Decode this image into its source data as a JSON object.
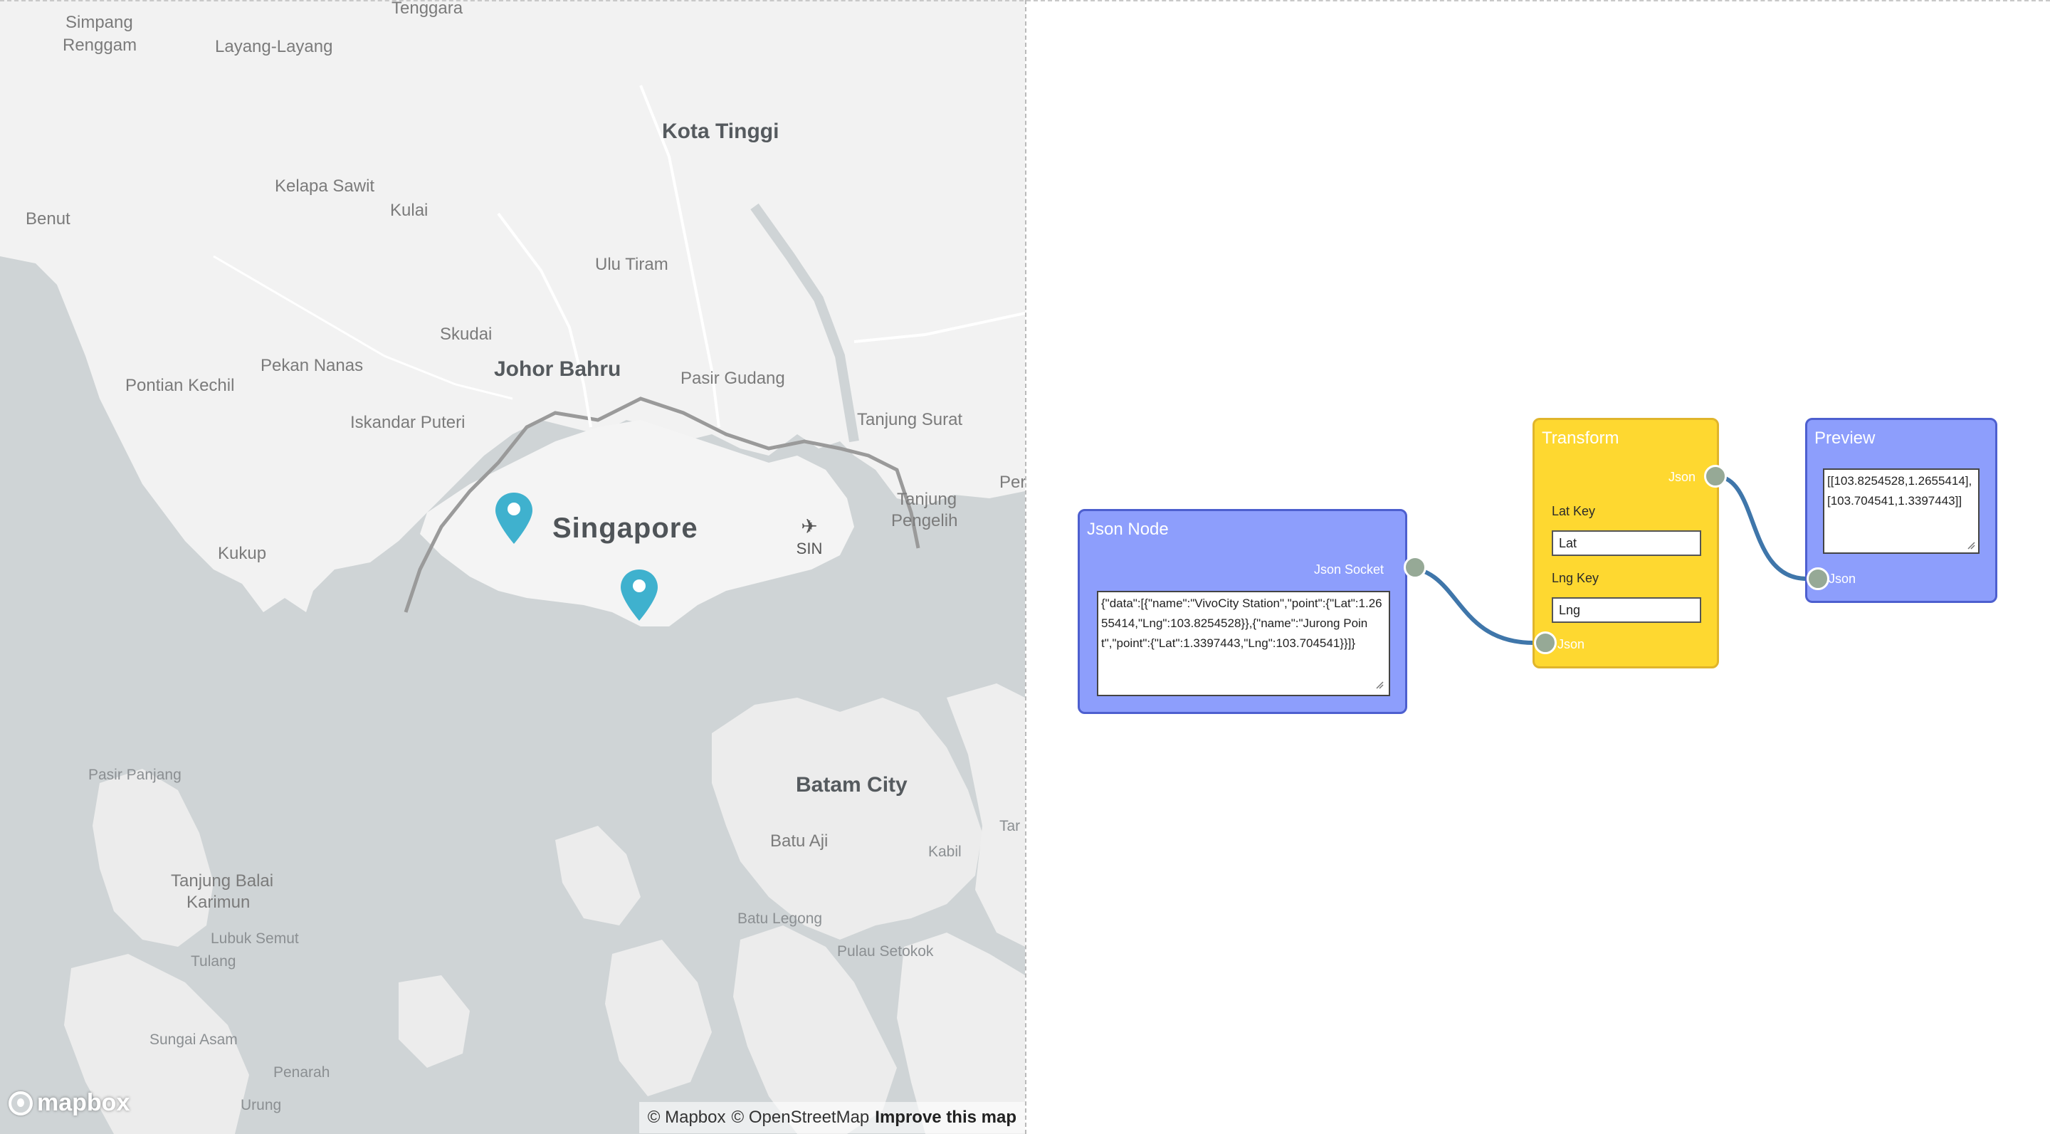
{
  "map": {
    "places": {
      "simpang_renggam_1": "Simpang",
      "simpang_renggam_2": "Renggam",
      "tenggara": "Tenggara",
      "layang_layang": "Layang-Layang",
      "kota_tinggi": "Kota Tinggi",
      "kelapa_sawit": "Kelapa Sawit",
      "benut": "Benut",
      "kulai": "Kulai",
      "ulu_tiram": "Ulu Tiram",
      "skudai": "Skudai",
      "pekan_nanas": "Pekan Nanas",
      "johor_bahru": "Johor Bahru",
      "pasir_gudang": "Pasir Gudang",
      "pontian_kechil": "Pontian Kechil",
      "iskandar_puteri": "Iskandar Puteri",
      "tanjung_surat": "Tanjung Surat",
      "tanjung_pengelih_1": "Tanjung",
      "tanjung_pengelih_2": "Pengelih",
      "per": "Per",
      "singapore": "Singapore",
      "kukup": "Kukup",
      "pasir_panjang": "Pasir Panjang",
      "batam_city": "Batam City",
      "batu_aji": "Batu Aji",
      "kabil": "Kabil",
      "tar": "Tar",
      "tanjung_balai_karimun_1": "Tanjung Balai",
      "tanjung_balai_karimun_2": "Karimun",
      "lubuk_semut": "Lubuk Semut",
      "tulang": "Tulang",
      "batu_legong": "Batu Legong",
      "pulau_setokok": "Pulau Setokok",
      "sungai_asam": "Sungai Asam",
      "penarah": "Penarah",
      "urung": "Urung"
    },
    "airport_code": "SIN",
    "airport_icon": "✈",
    "logo_text": "mapbox",
    "attribution": {
      "mapbox": "© Mapbox",
      "osm": "© OpenStreetMap",
      "improve": "Improve this map"
    },
    "colors": {
      "land": "#f2f2f2",
      "water": "#cfd4d6",
      "marker": "#3fb1ce"
    }
  },
  "editor": {
    "json_node": {
      "title": "Json Node",
      "output_label": "Json Socket",
      "value": "{\"data\":[{\"name\":\"VivoCity Station\",\"point\":{\"Lat\":1.2655414,\"Lng\":103.8254528}},{\"name\":\"Jurong Point\",\"point\":{\"Lat\":1.3397443,\"Lng\":103.704541}}]}"
    },
    "transform_node": {
      "title": "Transform",
      "output_label": "Json",
      "input_label": "Json",
      "lat_key_label": "Lat Key",
      "lat_key_value": "Lat",
      "lng_key_label": "Lng Key",
      "lng_key_value": "Lng"
    },
    "preview_node": {
      "title": "Preview",
      "input_label": "Json",
      "value": "[[103.8254528,1.2655414],[103.704541,1.3397443]]"
    },
    "colors": {
      "blue_node": "#8d9efc",
      "yellow_node": "#fed830",
      "socket": "#96a996",
      "wire": "#3f76aa"
    }
  }
}
